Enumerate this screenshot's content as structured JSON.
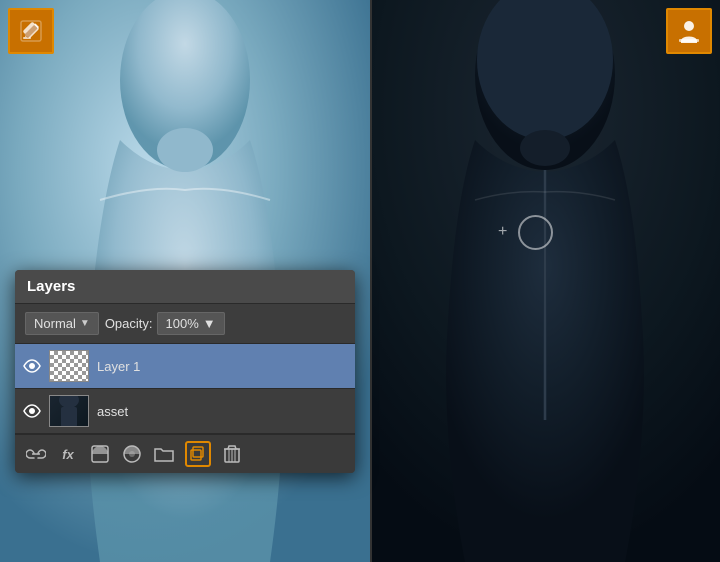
{
  "toolbar": {
    "edit_icon_label": "edit-icon",
    "stamp_icon_label": "stamp-icon"
  },
  "layers_panel": {
    "title": "Layers",
    "blend_mode": "Normal",
    "blend_chevron": "▼",
    "opacity_label": "Opacity:",
    "opacity_value": "100%",
    "opacity_chevron": "▼",
    "layers": [
      {
        "name": "Layer 1",
        "visible": true,
        "selected": true,
        "thumb_type": "transparent"
      },
      {
        "name": "asset",
        "visible": true,
        "selected": false,
        "thumb_type": "asset"
      }
    ],
    "toolbar_icons": [
      {
        "name": "link-icon",
        "symbol": "⛓",
        "highlighted": false
      },
      {
        "name": "fx-icon",
        "symbol": "fx",
        "highlighted": false
      },
      {
        "name": "mask-icon",
        "symbol": "◑",
        "highlighted": false
      },
      {
        "name": "adjustment-icon",
        "symbol": "◕",
        "highlighted": false
      },
      {
        "name": "folder-icon",
        "symbol": "📁",
        "highlighted": false
      },
      {
        "name": "new-layer-icon",
        "symbol": "⧉",
        "highlighted": true
      },
      {
        "name": "delete-icon",
        "symbol": "🗑",
        "highlighted": false
      }
    ]
  }
}
